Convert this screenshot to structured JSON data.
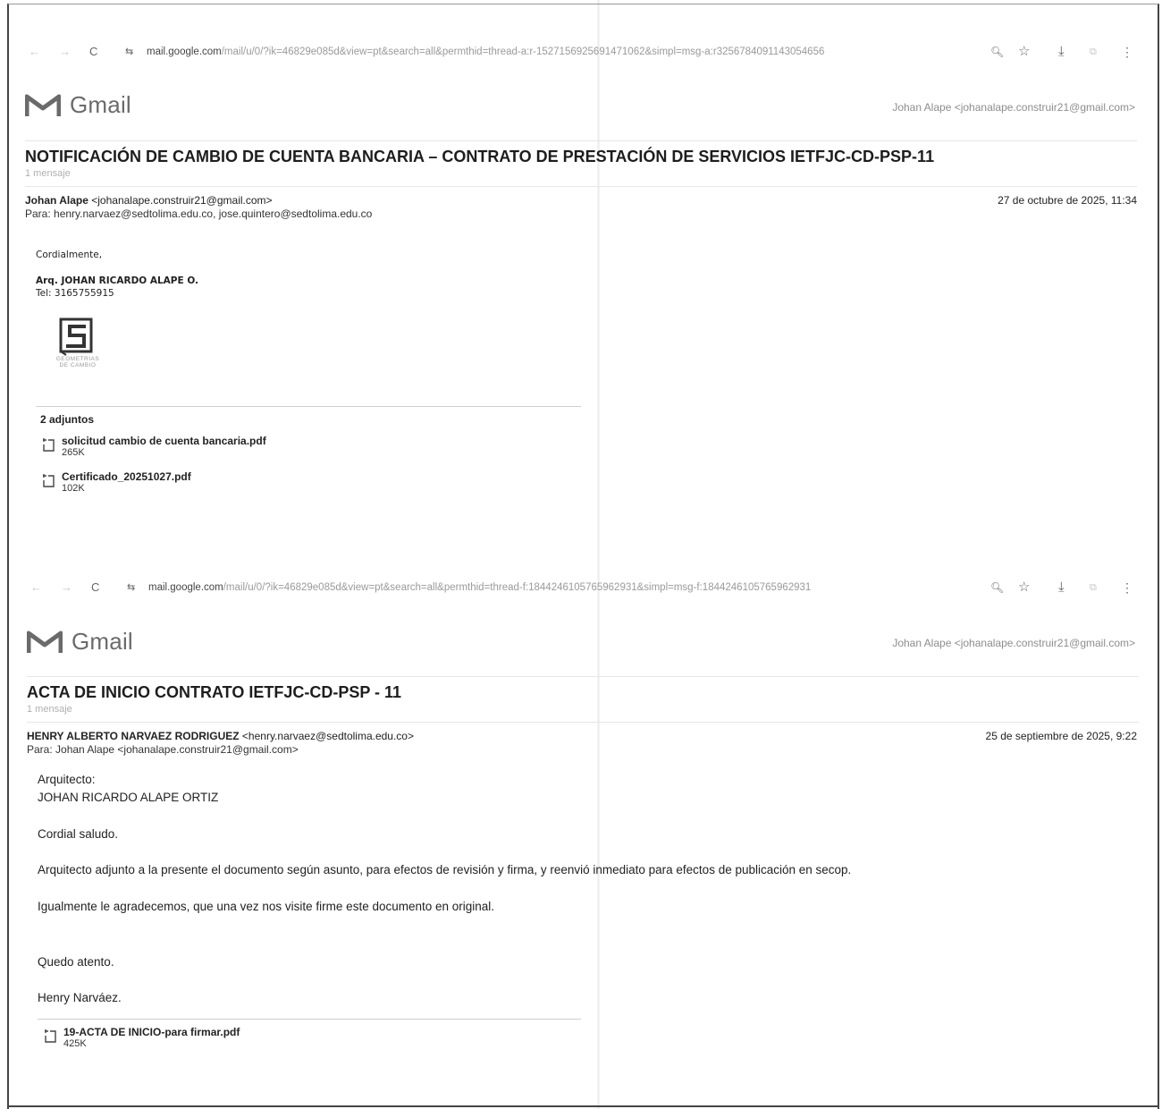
{
  "browser1": {
    "url_host": "mail.google.com",
    "url_path": "/mail/u/0/?ik=46829e085d&view=pt&search=all&permthid=thread-a:r-1527156925691471062&simpl=msg-a:r3256784091143054656"
  },
  "browser2": {
    "url_host": "mail.google.com",
    "url_path": "/mail/u/0/?ik=46829e085d&view=pt&search=all&permthid=thread-f:1844246105765962931&simpl=msg-f:1844246105765962931"
  },
  "icons": {
    "back": "←",
    "forward": "→",
    "reload": "C",
    "site_settings": "⇆",
    "zoom": "🔍︎",
    "star": "☆",
    "download": "⤓",
    "cast": "⧉",
    "menu": "⋮"
  },
  "gmail": {
    "logo_text": "Gmail",
    "account": "Johan Alape <johanalape.construir21@gmail.com>"
  },
  "email1": {
    "subject": "NOTIFICACIÓN DE CAMBIO DE CUENTA BANCARIA – CONTRATO DE PRESTACIÓN DE SERVICIOS IETFJC-CD-PSP-11",
    "count": "1 mensaje",
    "sender_name": "Johan Alape",
    "sender_email": "<johanalape.construir21@gmail.com>",
    "to": "Para: henry.narvaez@sedtolima.edu.co, jose.quintero@sedtolima.edu.co",
    "date": "27 de octubre de 2025, 11:34",
    "closing": "Cordialmente,",
    "sig_name": "Arq. JOHAN RICARDO ALAPE O.",
    "sig_tel": "Tel: 3165755915",
    "attachments_label": "2 adjuntos",
    "attachments": [
      {
        "name": "solicitud cambio de cuenta bancaria.pdf",
        "size": "265K"
      },
      {
        "name": "Certificado_20251027.pdf",
        "size": "102K"
      }
    ]
  },
  "email2": {
    "subject": "ACTA DE INICIO CONTRATO IETFJC-CD-PSP - 11",
    "count": "1 mensaje",
    "sender_name": "HENRY ALBERTO NARVAEZ RODRIGUEZ",
    "sender_email": "<henry.narvaez@sedtolima.edu.co>",
    "to": "Para: Johan Alape <johanalape.construir21@gmail.com>",
    "date": "25 de septiembre de 2025, 9:22",
    "body": [
      "Arquitecto:",
      "JOHAN RICARDO ALAPE ORTIZ",
      "Cordial saludo.",
      "Arquitecto adjunto a la presente el documento según asunto, para efectos de revisión y firma, y reenvió inmediato para efectos de publicación en secop.",
      "Igualmente le agradecemos, que una vez nos visite firme este documento en original.",
      "Quedo atento.",
      "Henry Narváez."
    ],
    "attachments": [
      {
        "name": "19-ACTA DE INICIO-para firmar.pdf",
        "size": "425K"
      }
    ]
  }
}
